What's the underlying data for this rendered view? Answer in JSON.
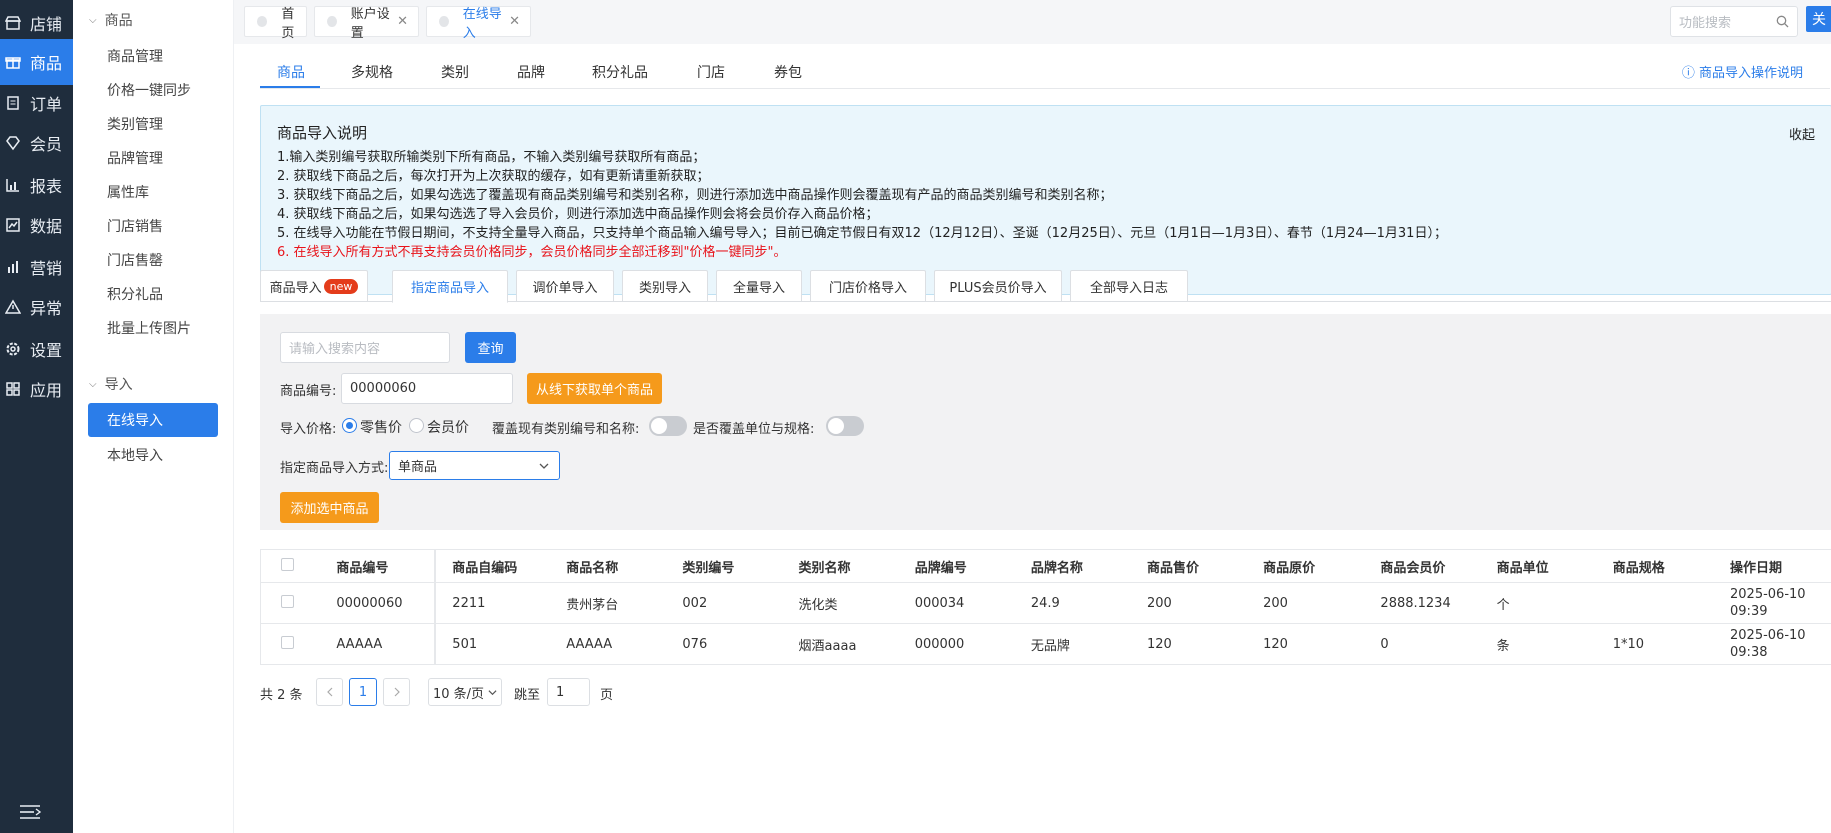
{
  "rail": {
    "items": [
      {
        "label": "店铺",
        "icon": "shop-icon"
      },
      {
        "label": "商品",
        "icon": "gift-icon"
      },
      {
        "label": "订单",
        "icon": "order-icon"
      },
      {
        "label": "会员",
        "icon": "diamond-icon"
      },
      {
        "label": "报表",
        "icon": "report-icon"
      },
      {
        "label": "数据",
        "icon": "data-icon"
      },
      {
        "label": "营销",
        "icon": "marketing-icon"
      },
      {
        "label": "异常",
        "icon": "warning-icon"
      },
      {
        "label": "设置",
        "icon": "gear-icon"
      },
      {
        "label": "应用",
        "icon": "apps-icon"
      }
    ],
    "active_index": 1,
    "collapse_icon": "menu-collapse-icon"
  },
  "submenu": {
    "group1": "商品",
    "group1_items": [
      "商品管理",
      "价格一键同步",
      "类别管理",
      "品牌管理",
      "属性库",
      "门店销售",
      "门店售罄",
      "积分礼品",
      "批量上传图片"
    ],
    "group2": "导入",
    "group2_items": [
      "在线导入",
      "本地导入"
    ]
  },
  "topbar": {
    "tabs": [
      {
        "label": "首页"
      },
      {
        "label": "账户设置",
        "close": "✕"
      },
      {
        "label": "在线导入",
        "close": "✕"
      }
    ],
    "search_placeholder": "功能搜索",
    "right_button": "关"
  },
  "section_tabs": [
    "商品",
    "多规格",
    "类别",
    "品牌",
    "积分礼品",
    "门店",
    "券包"
  ],
  "help_link": "商品导入操作说明",
  "notice": {
    "title": "商品导入说明",
    "collapse": "收起",
    "lines": [
      "1.输入类别编号获取所输类别下所有商品，不输入类别编号获取所有商品；",
      "2. 获取线下商品之后，每次打开为上次获取的缓存，如有更新请重新获取；",
      "3. 获取线下商品之后，如果勾选选了覆盖现有商品类别编号和类别名称，则进行添加选中商品操作则会覆盖现有产品的商品类别编号和类别名称；",
      "4. 获取线下商品之后，如果勾选选了导入会员价，则进行添加选中商品操作则会将会员价存入商品价格；",
      "5. 在线导入功能在节假日期间，不支持全量导入商品，只支持单个商品输入编号导入；目前已确定节假日有双12（12月12日）、圣诞（12月25日）、元旦（1月1日—1月3日）、春节（1月24—1月31日）；",
      "6. 在线导入所有方式不再支持会员价格同步，会员价格同步全部迁移到\"价格一键同步\"。"
    ]
  },
  "import_tabs": [
    {
      "label": "商品导入",
      "badge": "new"
    },
    {
      "label": "指定商品导入"
    },
    {
      "label": "调价单导入"
    },
    {
      "label": "类别导入"
    },
    {
      "label": "全量导入"
    },
    {
      "label": "门店价格导入"
    },
    {
      "label": "PLUS会员价导入"
    },
    {
      "label": "全部导入日志"
    }
  ],
  "form": {
    "search_placeholder": "请输入搜索内容",
    "query_button": "查询",
    "code_label": "商品编号:",
    "code_value": "00000060",
    "fetch_button": "从线下获取单个商品",
    "price_label": "导入价格:",
    "price_options": [
      "零售价",
      "会员价"
    ],
    "price_selected": "零售价",
    "cover_label": "覆盖现有类别编号和名称:",
    "cover_on": false,
    "unit_label": "是否覆盖单位与规格:",
    "unit_on": false,
    "mode_label": "指定商品导入方式:",
    "mode_value": "单商品",
    "add_button": "添加选中商品"
  },
  "table": {
    "headers": [
      "商品编号",
      "商品自编码",
      "商品名称",
      "类别编号",
      "类别名称",
      "品牌编号",
      "品牌名称",
      "商品售价",
      "商品原价",
      "商品会员价",
      "商品单位",
      "商品规格",
      "操作日期"
    ],
    "rows": [
      {
        "cells": [
          "00000060",
          "2211",
          "贵州茅台",
          "002",
          "洗化类",
          "000034",
          "24.9",
          "200",
          "200",
          "2888.1234",
          "个",
          ""
        ],
        "date1": "2025-06-10",
        "date2": "09:39"
      },
      {
        "cells": [
          "AAAAA",
          "501",
          "AAAAA",
          "076",
          "烟酒aaaa",
          "000000",
          "无品牌",
          "120",
          "120",
          "0",
          "条",
          "1*10"
        ],
        "date1": "2025-06-10",
        "date2": "09:38"
      }
    ]
  },
  "pagination": {
    "total": "共 2 条",
    "page": "1",
    "page_size": "10 条/页",
    "jump_label": "跳至",
    "jump_value": "1",
    "page_suffix": "页"
  },
  "colors": {
    "accent": "#2b7de9",
    "orange": "#f59a1b",
    "rail_bg": "#1f2d3d",
    "danger": "#e8141b"
  }
}
